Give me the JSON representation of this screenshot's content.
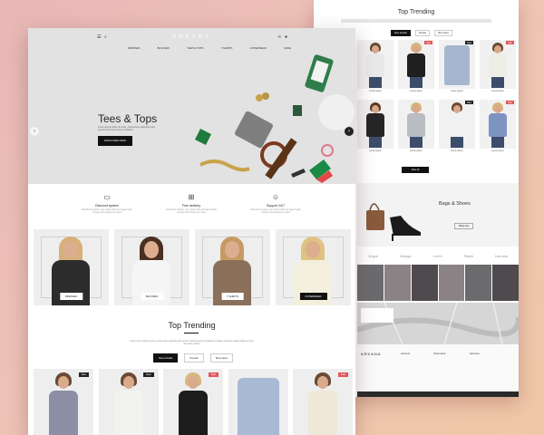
{
  "back_page": {
    "section_title": "Top Trending",
    "filter_tabs": [
      {
        "label": "New arrivals",
        "active": true
      },
      {
        "label": "Popular",
        "active": false
      },
      {
        "label": "Best sales",
        "active": false
      }
    ],
    "products": [
      {
        "caption": "Lorem ipsum",
        "badge": "",
        "color": "#e9e9ea",
        "hair": "#6b4a33"
      },
      {
        "caption": "Lorem ipsum",
        "badge": "Sale",
        "badge_color": "#e05757",
        "color": "#1f1f1f",
        "hair": "#d7b57a"
      },
      {
        "caption": "Lorem ipsum",
        "badge": "New",
        "badge_color": "#222222",
        "color": "#a7b6cf",
        "hair": ""
      },
      {
        "caption": "Lorem ipsum",
        "badge": "Sale",
        "badge_color": "#e05757",
        "color": "#eeeee6",
        "hair": "#6b4a33"
      },
      {
        "caption": "Lorem ipsum",
        "badge": "",
        "color": "#262626",
        "hair": "#5a3b26"
      },
      {
        "caption": "Lorem ipsum",
        "badge": "",
        "color": "#b9bcc2",
        "hair": "#d7b57a"
      },
      {
        "caption": "Lorem ipsum",
        "badge": "New",
        "badge_color": "#222222",
        "color": "#f1f1f1",
        "hair": "#6b4a33"
      },
      {
        "caption": "Lorem ipsum",
        "badge": "Sale",
        "badge_color": "#e05757",
        "color": "#7d93c2",
        "hair": "#d7b57a"
      }
    ],
    "view_all_label": "View all",
    "bags_title": "Bags & Shoes",
    "bags_button": "Shop now",
    "brands": [
      "Vogue",
      "Mango",
      "Levi's",
      "Ralph",
      "Lacoste"
    ],
    "footer_logo": "ARKANA",
    "footer_columns": [
      "Account",
      "Information",
      "Services"
    ]
  },
  "front_page": {
    "logo": "ARKANA",
    "nav": [
      "DRESSES",
      "BLOUSES",
      "TEES & TOPS",
      "T-SHIRTS",
      "OUTERWEAR",
      "SHOE"
    ],
    "hero": {
      "title": "Tees & Tops",
      "description": "Lorem ipsum dolor sit amet, consectetur adipiscing elit, sed do eiusmod tempor incididunt",
      "button": "DISCOVER NOW",
      "prev_icon": "chevron-left-icon",
      "next_icon": "chevron-right-icon"
    },
    "features": [
      {
        "icon": "wallet-icon",
        "title": "Discount system",
        "description": "Nam libero tempore cum soluta nobis est eligendi optio cumque nihil impedit quo minus"
      },
      {
        "icon": "gift-icon",
        "title": "Free delivery",
        "description": "Nam libero tempore cum soluta nobis est eligendi optio cumque nihil impedit quo minus"
      },
      {
        "icon": "users-icon",
        "title": "Support 24/7",
        "description": "Nam libero tempore cum soluta nobis est eligendi optio cumque nihil impedit quo minus"
      }
    ],
    "categories": [
      {
        "label": "DRESSES",
        "dark": false,
        "color": "#2c2c2c",
        "hair": "#d6b07a"
      },
      {
        "label": "BLOUSES",
        "dark": false,
        "color": "#f5f5f5",
        "hair": "#4a3020"
      },
      {
        "label": "T-SHIRTS",
        "dark": false,
        "color": "#8a6f5a",
        "hair": "#c89a63"
      },
      {
        "label": "OUTERWEAR",
        "dark": true,
        "color": "#f4efdd",
        "hair": "#e0c283"
      }
    ],
    "trending": {
      "title": "Top Trending",
      "description": "Lorem ipsum dolor sit amet consectetur adipiscing elit sed do eiusmod tempor incididunt ut labore et dolore magna aliqua ut enim ad minim veniam",
      "tabs": [
        {
          "label": "New arrivals",
          "active": true
        },
        {
          "label": "Popular",
          "active": false
        },
        {
          "label": "Best sales",
          "active": false
        }
      ],
      "products": [
        {
          "badge": "New",
          "badge_color": "#222222",
          "color": "#8d8fa6",
          "hair": "#6a4a35"
        },
        {
          "badge": "New",
          "badge_color": "#222222",
          "color": "#f2f2ef",
          "hair": "#6a4a35"
        },
        {
          "badge": "Sale",
          "badge_color": "#e05757",
          "color": "#1d1d1d",
          "hair": "#d8b77d"
        },
        {
          "badge": "",
          "color": "#a9bad4",
          "hair": ""
        },
        {
          "badge": "Sale",
          "badge_color": "#e05757",
          "color": "#efe8d8",
          "hair": "#6a4a35"
        }
      ]
    }
  }
}
